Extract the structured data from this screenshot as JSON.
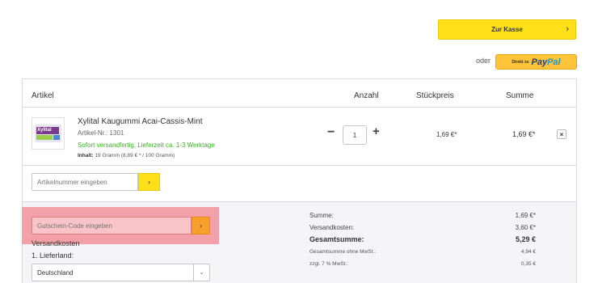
{
  "checkout": {
    "label": "Zur Kasse",
    "chevron": "›"
  },
  "paypal": {
    "or_label": "oder",
    "direkt": "Direkt zu",
    "brand_a": "Pay",
    "brand_b": "Pal"
  },
  "cart": {
    "headers": {
      "artikel": "Artikel",
      "anzahl": "Anzahl",
      "stueckpreis": "Stückpreis",
      "summe": "Summe"
    },
    "item": {
      "title": "Xylital Kaugummi Acai-Cassis-Mint",
      "number": "Artikel-Nr.: 1301",
      "shipping": "Sofort versandfertig, Lieferzeit ca. 1-3 Werktage",
      "content_label": "Inhalt:",
      "content_value": "19 Gramm (8,89 € * / 100 Gramm)",
      "thumb_text": "Xylital",
      "quantity": "1",
      "minus": "−",
      "plus": "+",
      "unit_price": "1,69 €*",
      "line_total": "1,69 €*",
      "remove": "×"
    },
    "article_input": {
      "placeholder": "Artikelnummer eingeben",
      "button": "›"
    }
  },
  "voucher": {
    "placeholder": "Gutschein-Code eingeben",
    "button": "›"
  },
  "shipping": {
    "title": "Versandkosten",
    "country_label": "1. Lieferland:",
    "country_value": "Deutschland",
    "chevron": "⌄"
  },
  "totals": {
    "summe_label": "Summe:",
    "summe_value": "1,69 €*",
    "versand_label": "Versandkosten:",
    "versand_value": "3,60 €*",
    "gesamt_label": "Gesamtsumme:",
    "gesamt_value": "5,29 €",
    "ohne_mwst_label": "Gesamtsumme ohne MwSt.:",
    "ohne_mwst_value": "4,94 €",
    "mwst_label": "zzgl. 7 % MwSt.:",
    "mwst_value": "0,35 €"
  },
  "colors": {
    "accent_yellow": "#ffe019",
    "voucher_highlight": "#f4a0a8",
    "voucher_button": "#f7a12b",
    "stock_green": "#3fae29"
  }
}
